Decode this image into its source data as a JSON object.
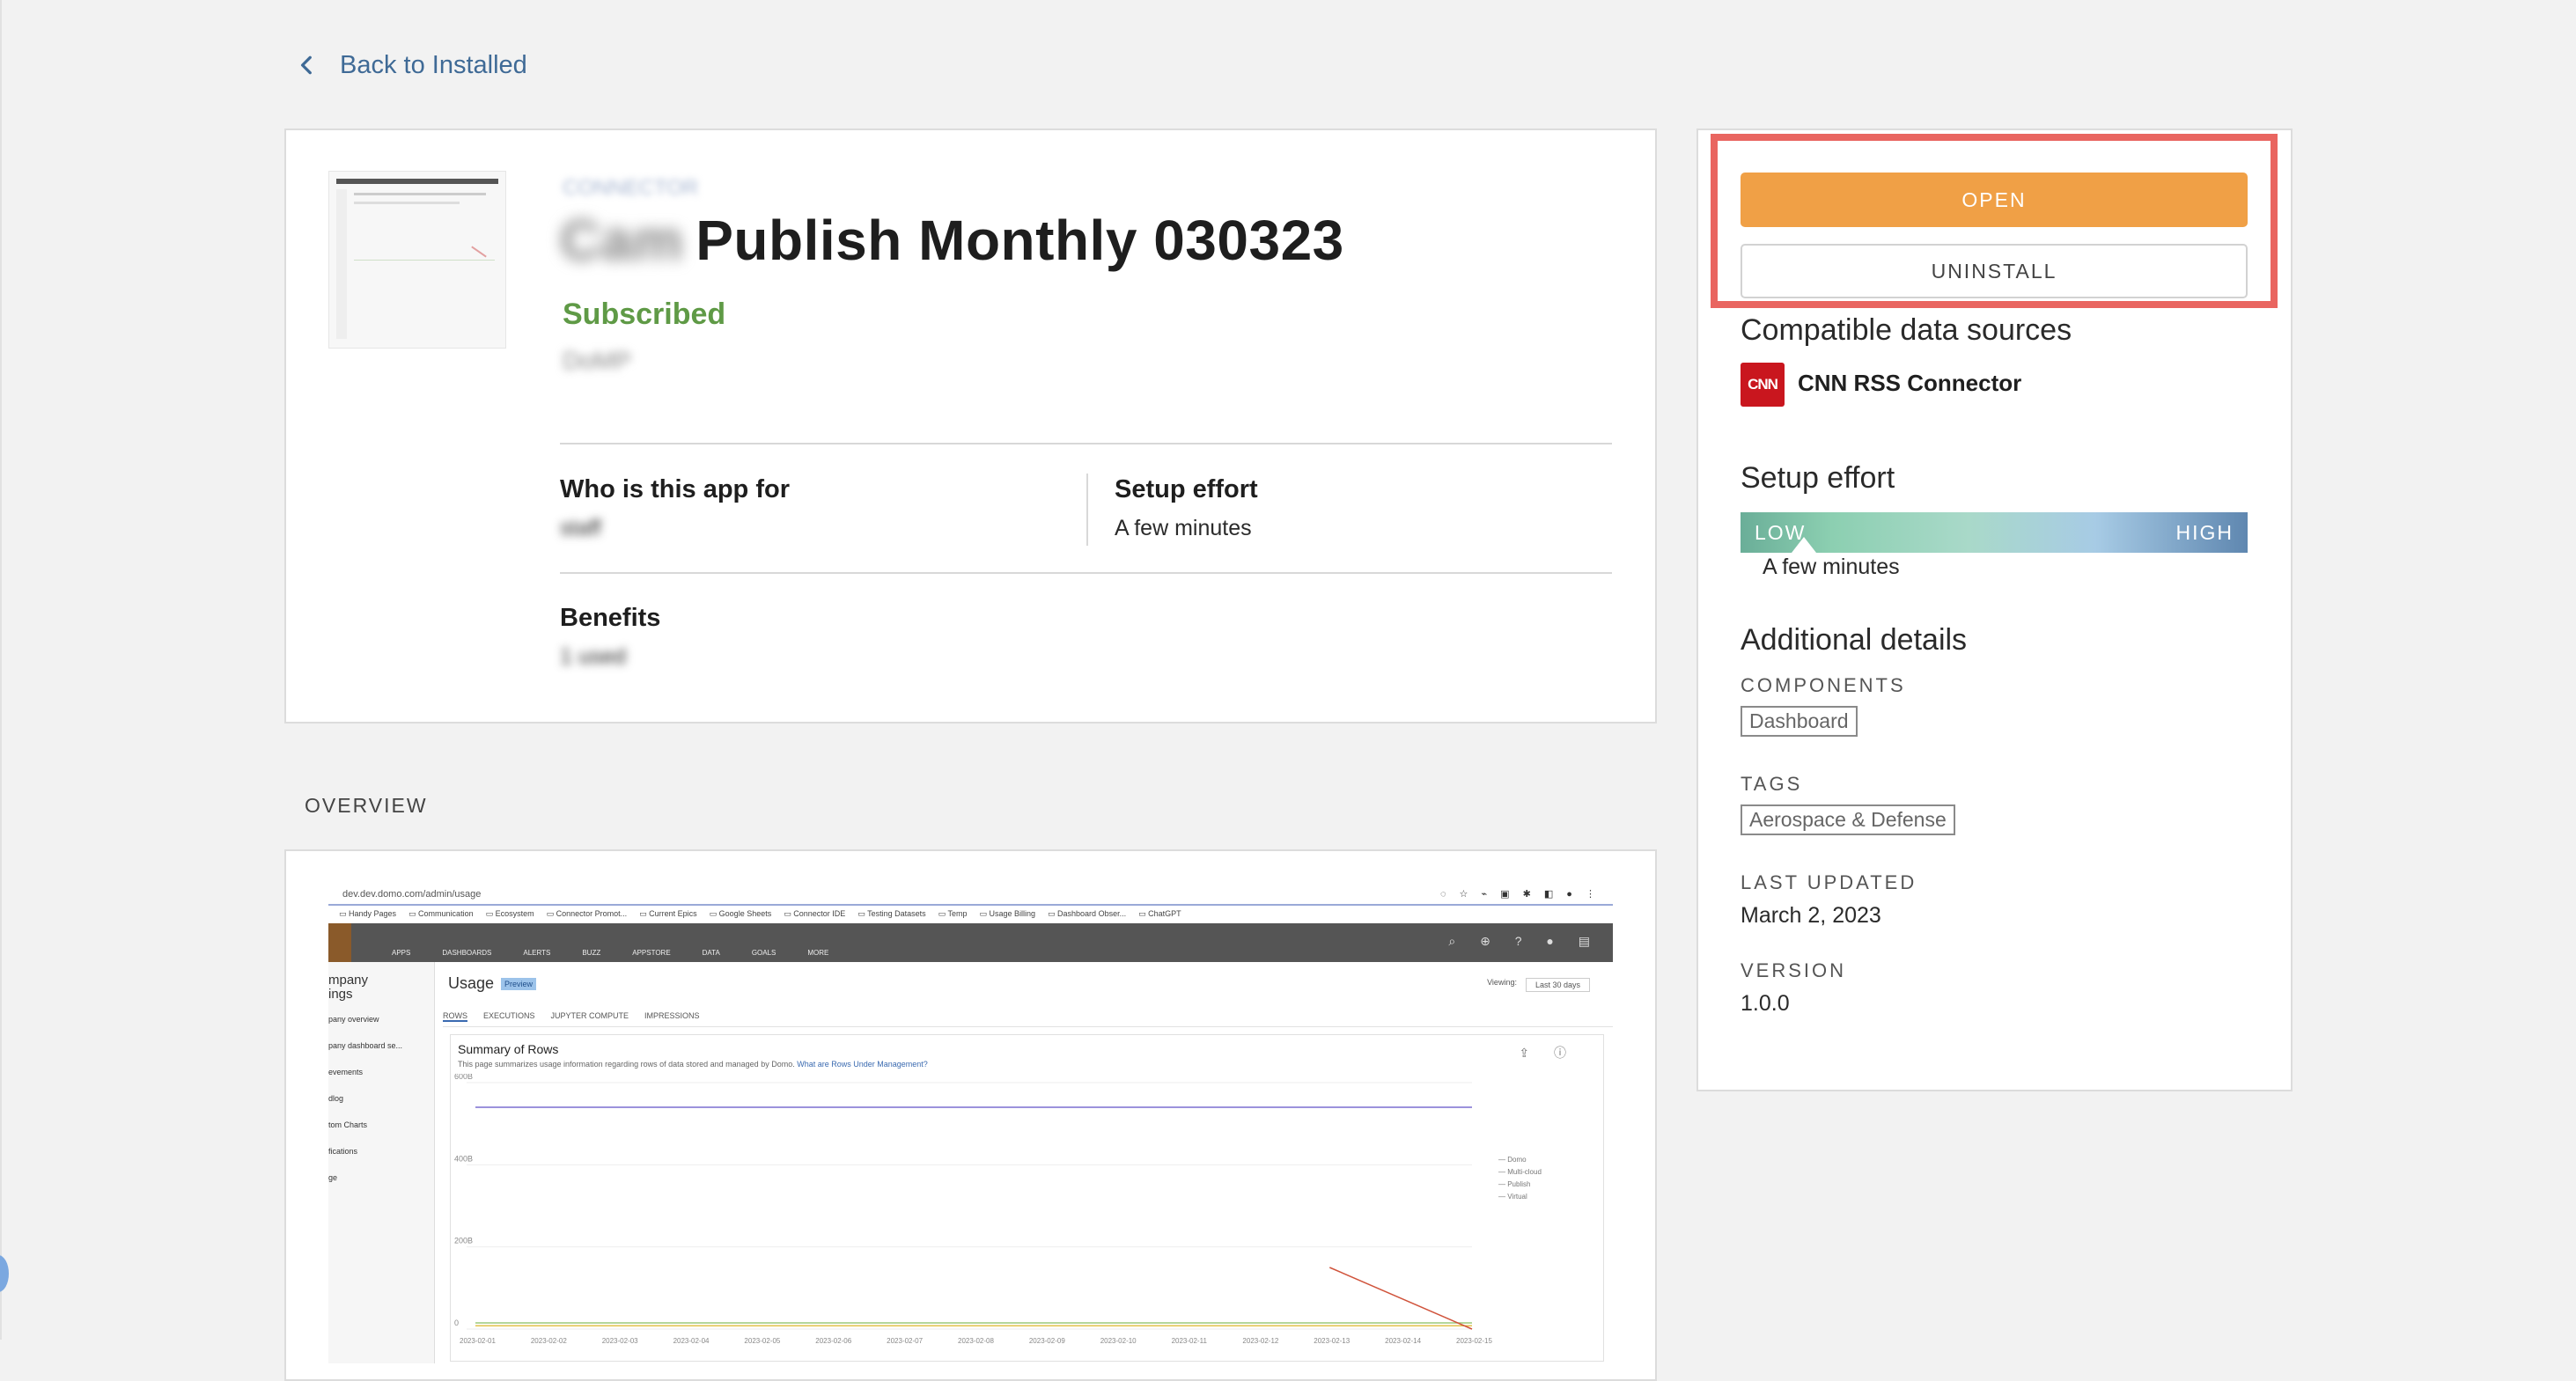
{
  "nav": {
    "back_label": "Back to Installed"
  },
  "app": {
    "breadcrumb": "CONNECTOR",
    "title_prefix": "Cam",
    "title": "Publish Monthly 030323",
    "status": "Subscribed",
    "author": "DoMP"
  },
  "details": {
    "who_label": "Who is this app for",
    "who_value": "staff",
    "setup_label": "Setup effort",
    "setup_value": "A few minutes",
    "benefits_label": "Benefits",
    "benefits_value": "1 used"
  },
  "overview": {
    "label": "OVERVIEW",
    "screenshot": {
      "url": "dev.dev.domo.com/admin/usage",
      "bookmarks": [
        "Handy Pages",
        "Communication",
        "Ecosystem",
        "Connector Promot...",
        "Current Epics",
        "Google Sheets",
        "Connector IDE",
        "Testing Datasets",
        "Temp",
        "Usage Billing",
        "Dashboard Obser...",
        "ChatGPT"
      ],
      "nav_items": [
        "APPS",
        "DASHBOARDS",
        "ALERTS",
        "BUZZ",
        "APPSTORE",
        "DATA",
        "GOALS",
        "MORE"
      ],
      "side_items": [
        "mpany",
        "ings",
        "pany overview",
        "pany dashboard se...",
        "evements",
        "dlog",
        "tom Charts",
        "fications",
        "ge"
      ],
      "page_title": "Usage",
      "badge": "Preview",
      "viewing_label": "Viewing:",
      "viewing_value": "Last 30 days",
      "tabs": [
        "ROWS",
        "EXECUTIONS",
        "JUPYTER COMPUTE",
        "IMPRESSIONS"
      ],
      "chart_title": "Summary of Rows",
      "chart_desc": "This page summarizes usage information regarding rows of data stored and managed by Domo.",
      "chart_link": "What are Rows Under Management?",
      "legend": [
        "Domo",
        "Multi-cloud",
        "Publish",
        "Virtual"
      ]
    }
  },
  "chart_data": {
    "type": "line",
    "title": "Summary of Rows",
    "x": [
      "2023-02-01",
      "2023-02-02",
      "2023-02-03",
      "2023-02-04",
      "2023-02-05",
      "2023-02-06",
      "2023-02-07",
      "2023-02-08",
      "2023-02-09",
      "2023-02-10",
      "2023-02-11",
      "2023-02-12",
      "2023-02-13",
      "2023-02-14",
      "2023-02-15"
    ],
    "y_ticks": [
      "600B",
      "400B",
      "200B",
      "0"
    ],
    "ylim": [
      0,
      600
    ],
    "series": [
      {
        "name": "Domo",
        "values": [
          540,
          540,
          540,
          540,
          540,
          540,
          540,
          540,
          540,
          540,
          540,
          540,
          540,
          540,
          540
        ]
      },
      {
        "name": "Multi-cloud",
        "values": [
          15,
          15,
          15,
          15,
          15,
          15,
          15,
          15,
          15,
          15,
          15,
          15,
          15,
          15,
          15
        ]
      },
      {
        "name": "Publish",
        "values": [
          8,
          8,
          8,
          8,
          8,
          8,
          8,
          8,
          8,
          8,
          8,
          8,
          8,
          8,
          8
        ]
      },
      {
        "name": "Virtual",
        "values": [
          0,
          0,
          0,
          0,
          0,
          0,
          0,
          0,
          0,
          0,
          0,
          0,
          150,
          75,
          0
        ]
      }
    ]
  },
  "sidebar": {
    "open_label": "OPEN",
    "uninstall_label": "UNINSTALL",
    "compatible_title": "Compatible data sources",
    "cnn_logo": "CNN",
    "connector_name": "CNN RSS Connector",
    "setup_title": "Setup effort",
    "effort_low": "LOW",
    "effort_high": "HIGH",
    "effort_level": 0.12,
    "effort_value": "A few minutes",
    "additional_title": "Additional details",
    "components_label": "COMPONENTS",
    "components_value": "Dashboard",
    "tags_label": "TAGS",
    "tags_value": "Aerospace & Defense",
    "updated_label": "LAST UPDATED",
    "updated_value": "March 2, 2023",
    "version_label": "VERSION",
    "version_value": "1.0.0"
  },
  "colors": {
    "accent_orange": "#f0a046",
    "subscribed_green": "#5f9a46",
    "highlight_red": "#e96560",
    "link_blue": "#3f6a96"
  }
}
